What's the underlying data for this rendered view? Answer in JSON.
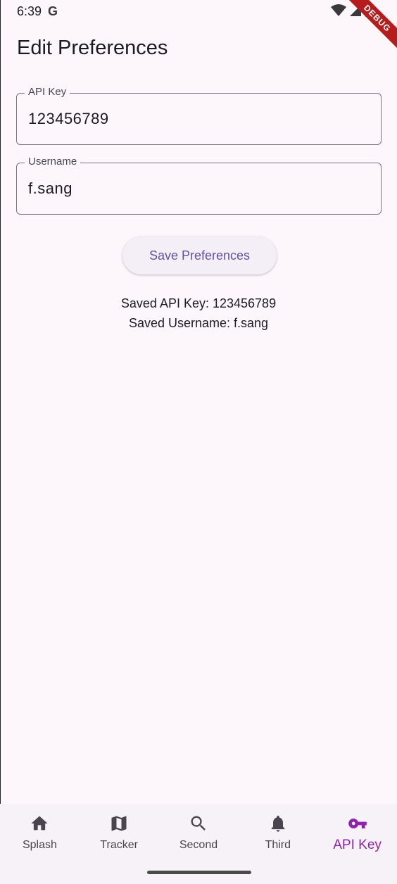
{
  "status_bar": {
    "time": "6:39",
    "google_glyph": "G",
    "debug_banner": "DEBUG"
  },
  "page": {
    "title": "Edit Preferences"
  },
  "form": {
    "api_key": {
      "label": "API Key",
      "value": "123456789"
    },
    "username": {
      "label": "Username",
      "value": "f.sang"
    },
    "save_label": "Save Preferences"
  },
  "saved": {
    "api_key_line": "Saved API Key: 123456789",
    "username_line": "Saved Username: f.sang"
  },
  "bottom_nav": {
    "items": [
      {
        "label": "Splash",
        "icon": "home-icon"
      },
      {
        "label": "Tracker",
        "icon": "map-icon"
      },
      {
        "label": "Second",
        "icon": "search-icon"
      },
      {
        "label": "Third",
        "icon": "bell-icon"
      },
      {
        "label": "API Key",
        "icon": "key-icon",
        "active": true
      }
    ]
  },
  "colors": {
    "background": "#fdf7fc",
    "accent": "#6750a4",
    "active_nav": "#8e24aa",
    "debug_ribbon": "#b71c1c"
  }
}
